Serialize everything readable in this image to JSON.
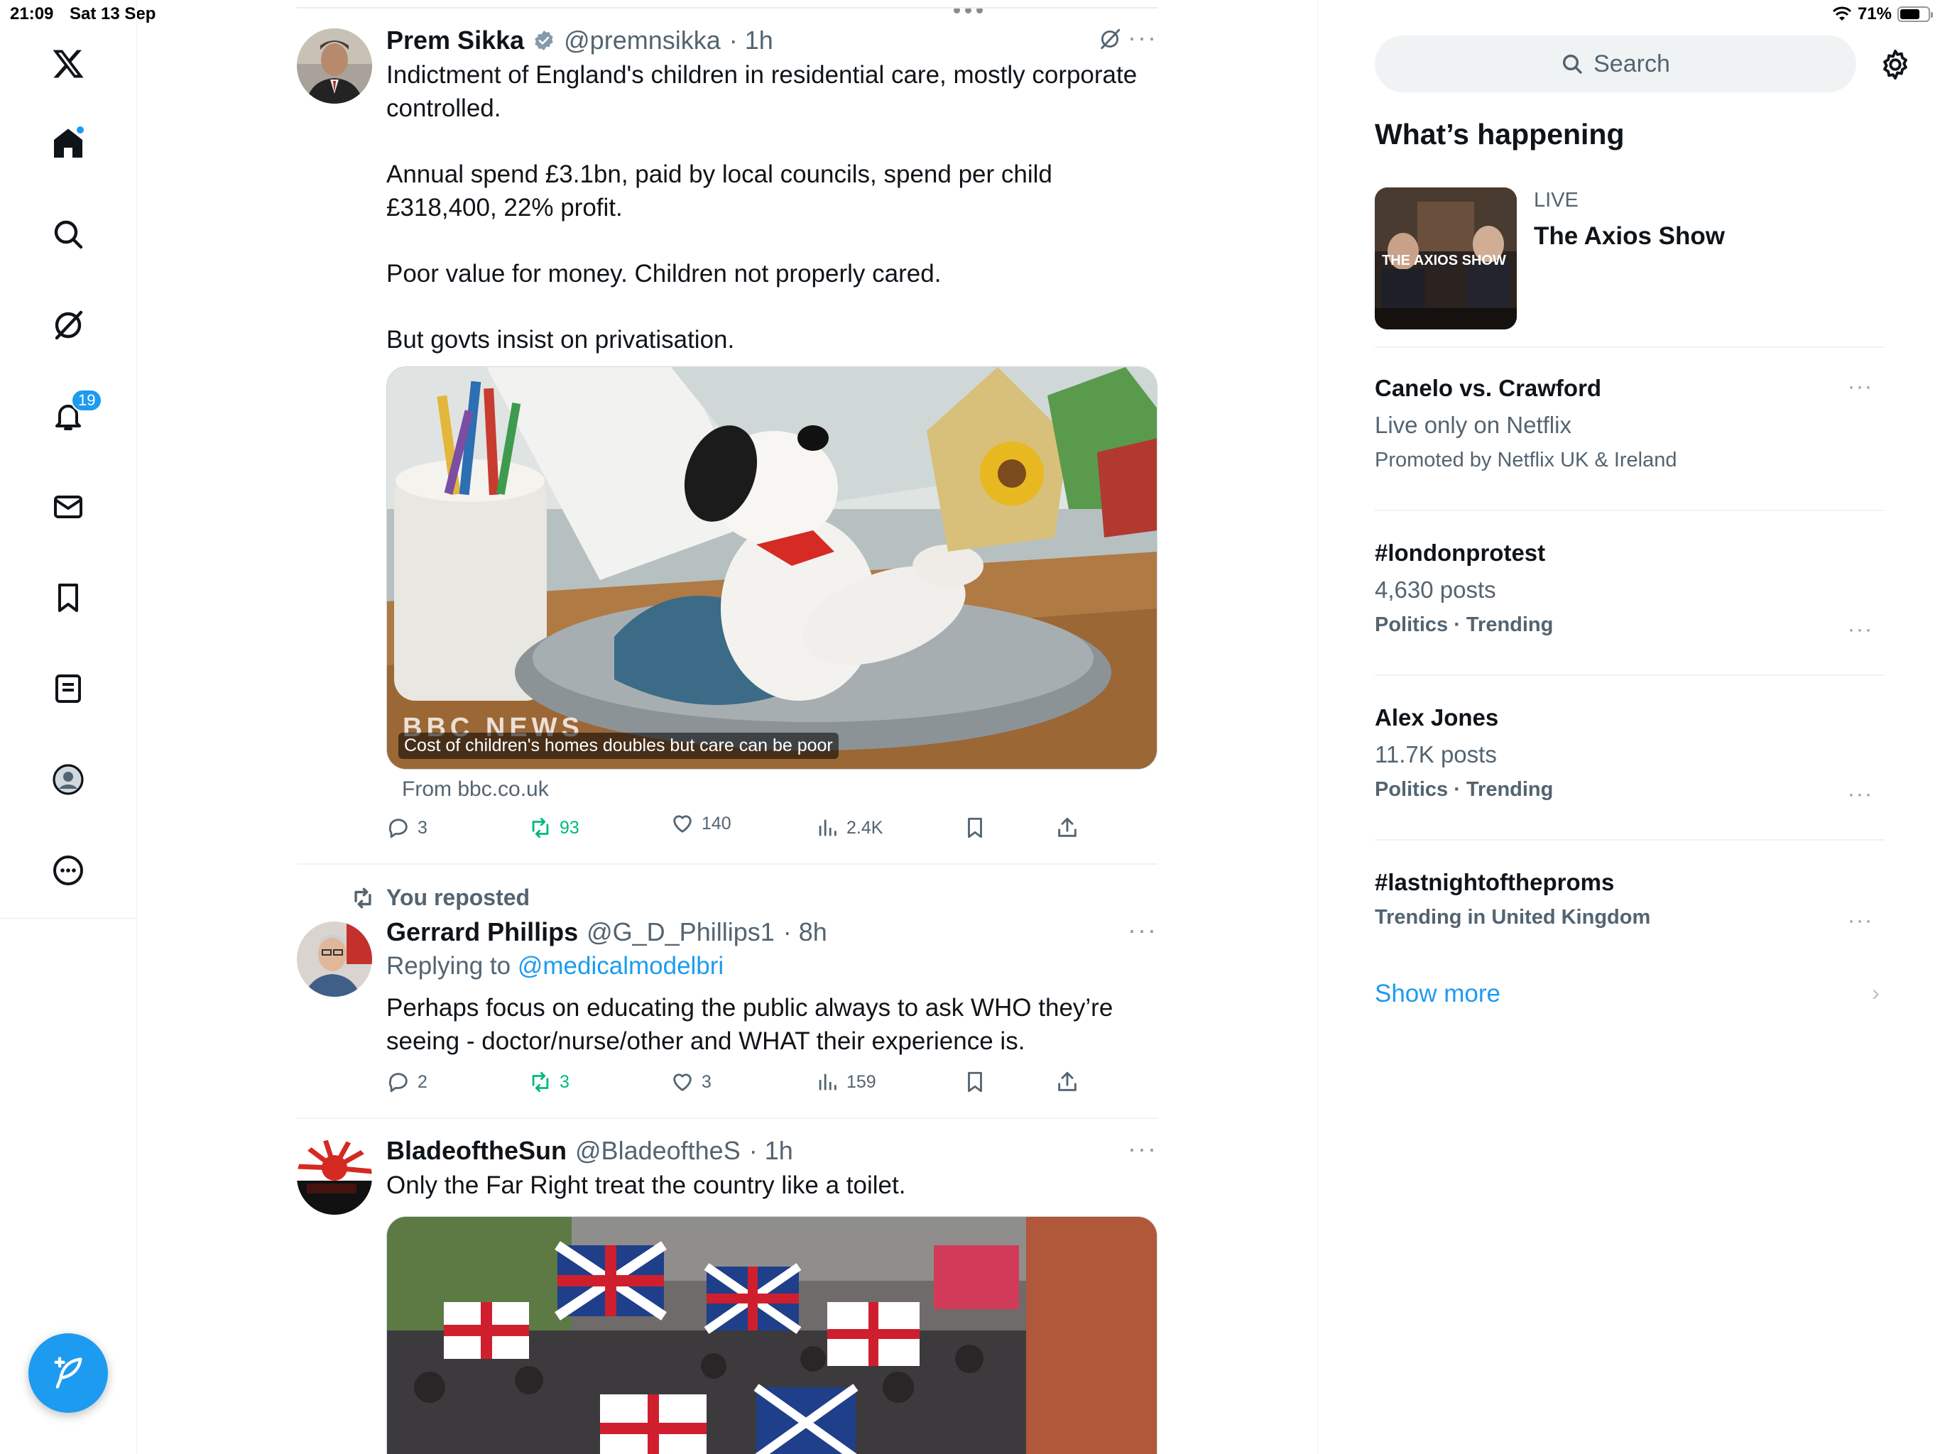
{
  "status_bar": {
    "time": "21:09",
    "date": "Sat 13 Sep",
    "battery": "71%",
    "battery_level": 0.71
  },
  "nav": {
    "notifications_badge": "19",
    "items": [
      "home",
      "explore",
      "grok",
      "notifications",
      "messages",
      "bookmarks",
      "lists",
      "profile",
      "more"
    ]
  },
  "tweets": [
    {
      "name": "Prem Sikka",
      "verified": true,
      "handle": "@premnsikka",
      "time": "· 1h",
      "paragraphs": [
        "Indictment of England's children in residential care, mostly corporate controlled.",
        "Annual spend £3.1bn, paid by local councils, spend per child £318,400, 22% profit.",
        "Poor value for money. Children not properly cared.",
        "But govts insist on privatisation."
      ],
      "media_caption": "Cost of children's homes doubles but care can be poor",
      "media_brand": "BBC NEWS",
      "source": "From bbc.co.uk",
      "replies": "3",
      "reposts": "93",
      "likes": "140",
      "views": "2.4K"
    },
    {
      "repost_label": "You reposted",
      "name": "Gerrard Phillips",
      "handle": "@G_D_Phillips1",
      "time": "· 8h",
      "replying_prefix": "Replying to",
      "replying_to": "@medicalmodelbri",
      "text": "Perhaps focus on educating the public always to ask WHO they’re seeing - doctor/nurse/other and WHAT their experience is.",
      "replies": "2",
      "reposts": "3",
      "likes": "3",
      "views": "159"
    },
    {
      "name": "BladeoftheSun",
      "handle": "@BladeoftheS",
      "time": "· 1h",
      "text": "Only the Far Right treat the country like a toilet."
    }
  ],
  "right": {
    "search_placeholder": "Search",
    "section_title": "What’s happening",
    "live": {
      "label": "LIVE",
      "title": "The Axios Show",
      "thumb_text": "THE AXIOS SHOW"
    },
    "trends": [
      {
        "title": "Canelo vs. Crawford",
        "subtitle": "Live only on Netflix",
        "meta": "Promoted by Netflix UK & Ireland"
      },
      {
        "title": "#londonprotest",
        "subtitle": "4,630 posts",
        "meta": "Politics · Trending"
      },
      {
        "title": "Alex Jones",
        "subtitle": "11.7K posts",
        "meta": "Politics · Trending"
      },
      {
        "title": "#lastnightoftheproms",
        "meta": "Trending in United Kingdom"
      }
    ],
    "show_more": "Show more"
  },
  "colors": {
    "accent": "#1d9bf0",
    "repost_green": "#00ba7c",
    "secondary_text": "#536471"
  }
}
